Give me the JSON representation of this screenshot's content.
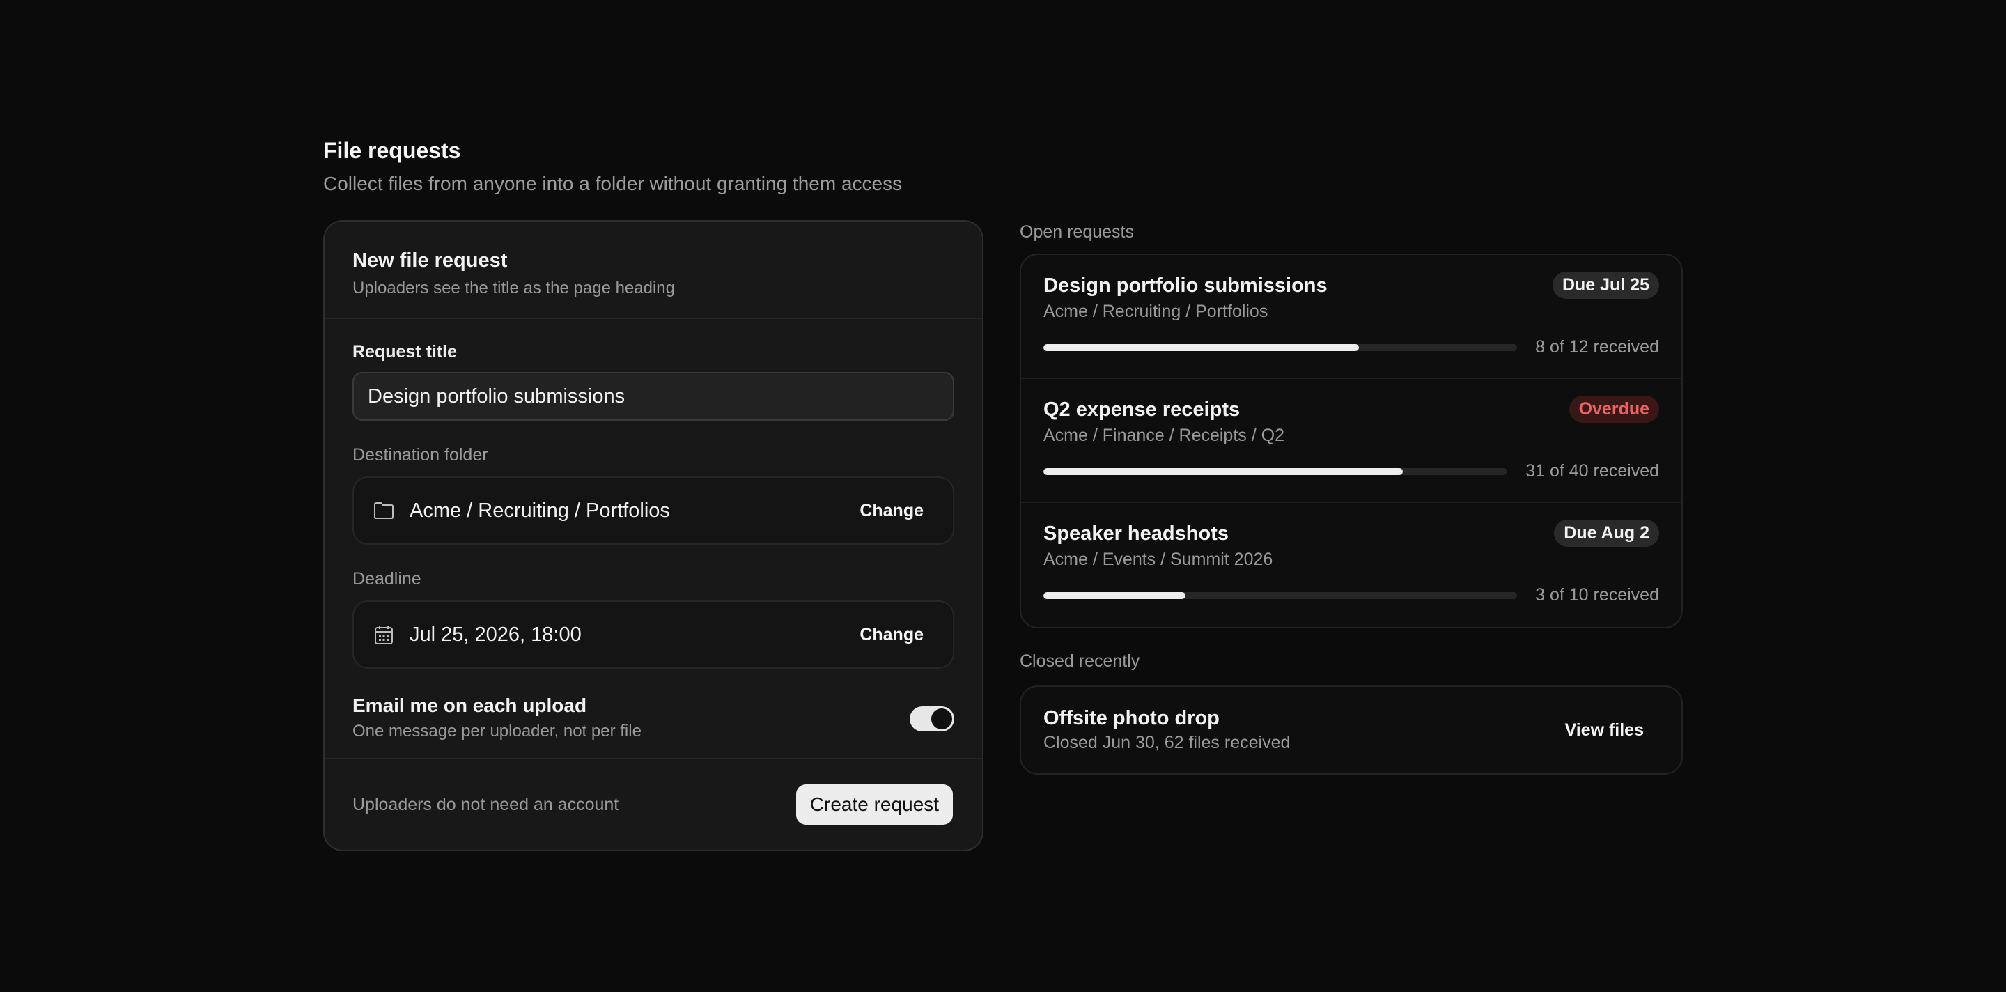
{
  "header": {
    "title": "File requests",
    "subtitle": "Collect files from anyone into a folder without granting them access"
  },
  "form": {
    "title": "New file request",
    "subtitle": "Uploaders see the title as the page heading",
    "request_title_label": "Request title",
    "request_title_value": "Design portfolio submissions",
    "destination_label": "Destination folder",
    "destination_value": "Acme / Recruiting / Portfolios",
    "destination_change": "Change",
    "deadline_label": "Deadline",
    "deadline_value": "Jul 25, 2026, 18:00",
    "deadline_change": "Change",
    "email_toggle_title": "Email me on each upload",
    "email_toggle_sub": "One message per uploader, not per file",
    "email_toggle_on": true,
    "footer_note": "Uploaders do not need an account",
    "create_button": "Create request"
  },
  "open_requests": {
    "label": "Open requests",
    "items": [
      {
        "title": "Design portfolio submissions",
        "badge": "Due Jul 25",
        "path": "Acme / Recruiting / Portfolios",
        "progress_text": "8 of 12 received",
        "received": 8,
        "total": 12
      },
      {
        "title": "Q2 expense receipts",
        "badge": "Overdue",
        "path": "Acme / Finance / Receipts / Q2",
        "progress_text": "31 of 40 received",
        "received": 31,
        "total": 40
      },
      {
        "title": "Speaker headshots",
        "badge": "Due Aug 2",
        "path": "Acme / Events / Summit 2026",
        "progress_text": "3 of 10 received",
        "received": 3,
        "total": 10
      }
    ]
  },
  "closed_recently": {
    "label": "Closed recently",
    "title": "Offsite photo drop",
    "subtitle": "Closed Jun 30, 62 files received",
    "button": "View files"
  },
  "colors": {
    "background": "#0b0b0b",
    "card": "#181818",
    "overdue": "#f06262",
    "toggle_on": "#e7e7e7"
  }
}
